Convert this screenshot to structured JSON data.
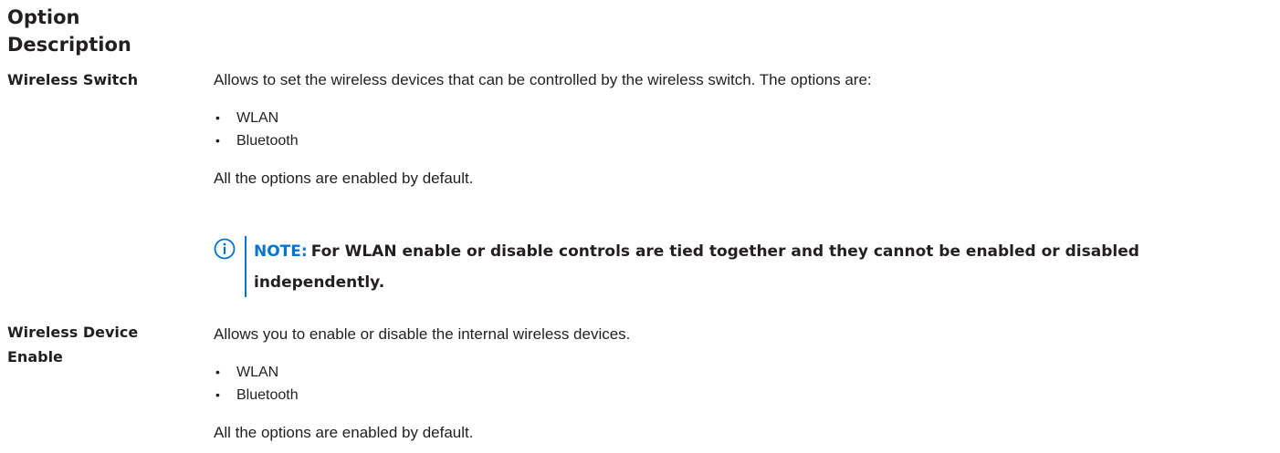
{
  "header": {
    "col1": "Option",
    "col2": "Description"
  },
  "rows": [
    {
      "label": "Wireless Switch",
      "intro": "Allows to set the wireless devices that can be controlled by the wireless switch. The options are:",
      "options": [
        "WLAN",
        "Bluetooth"
      ],
      "footer": "All the options are enabled by default.",
      "note": {
        "label": "NOTE:",
        "text": "For WLAN enable or disable controls are tied together and they cannot be enabled or disabled independently.",
        "icon": "info-icon"
      }
    },
    {
      "label": "Wireless Device Enable",
      "intro": "Allows you to enable or disable the internal wireless devices.",
      "options": [
        "WLAN",
        "Bluetooth"
      ],
      "footer": "All the options are enabled by default."
    }
  ],
  "colors": {
    "text": "#231f20",
    "accent": "#0076ce"
  }
}
